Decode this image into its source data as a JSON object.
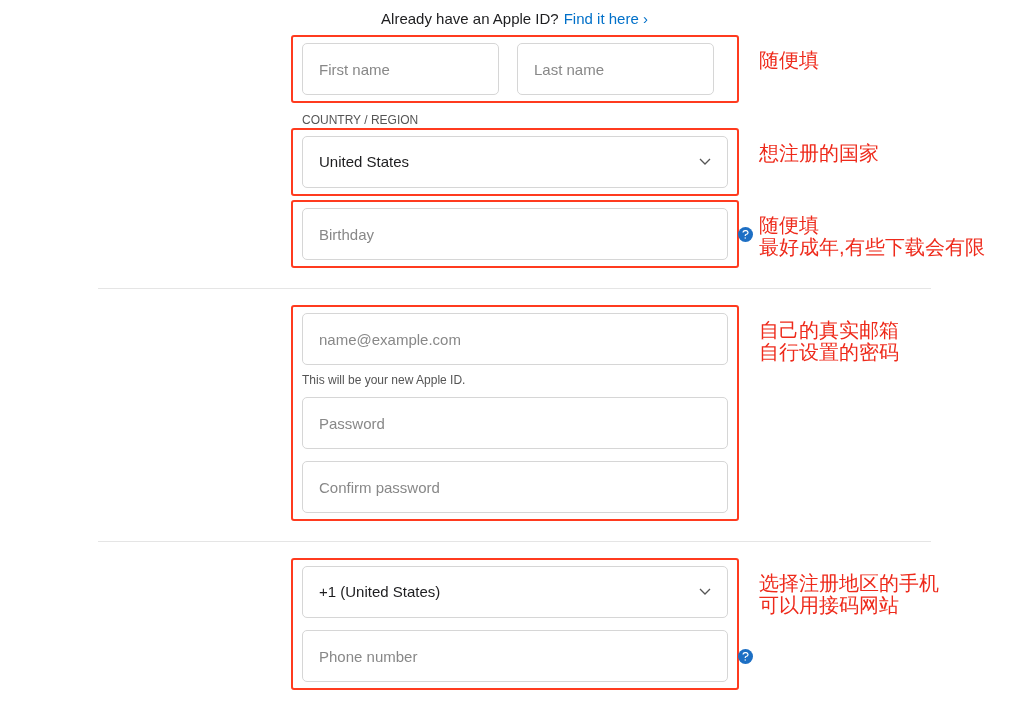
{
  "intro": {
    "text": "Already have an Apple ID?",
    "link": "Find it here ›"
  },
  "sections": [
    {
      "groups": [
        {
          "fields": [
            {
              "kind": "pair",
              "items": [
                {
                  "placeholder": "First name"
                },
                {
                  "placeholder": "Last name"
                }
              ]
            }
          ],
          "note": [
            "随便填"
          ]
        },
        {
          "label": "COUNTRY / REGION",
          "fields": [
            {
              "kind": "select",
              "value": "United States"
            }
          ],
          "note": [
            "想注册的国家"
          ]
        },
        {
          "fields": [
            {
              "kind": "text",
              "placeholder": "Birthday",
              "help": true
            }
          ],
          "note": [
            "随便填",
            "最好成年,有些下载会有限"
          ]
        }
      ]
    },
    {
      "groups": [
        {
          "fields": [
            {
              "kind": "text",
              "placeholder": "name@example.com"
            },
            {
              "kind": "hint",
              "text": "This will be your new Apple ID."
            },
            {
              "kind": "text",
              "placeholder": "Password"
            },
            {
              "kind": "text",
              "placeholder": "Confirm password"
            }
          ],
          "note": [
            "自己的真实邮箱",
            "自行设置的密码"
          ]
        }
      ]
    },
    {
      "groups": [
        {
          "fields": [
            {
              "kind": "select",
              "value": "+1 (United States)"
            },
            {
              "kind": "text",
              "placeholder": "Phone number",
              "help": true
            }
          ],
          "note": [
            "选择注册地区的手机",
            "可以用接码网站"
          ]
        }
      ]
    }
  ]
}
